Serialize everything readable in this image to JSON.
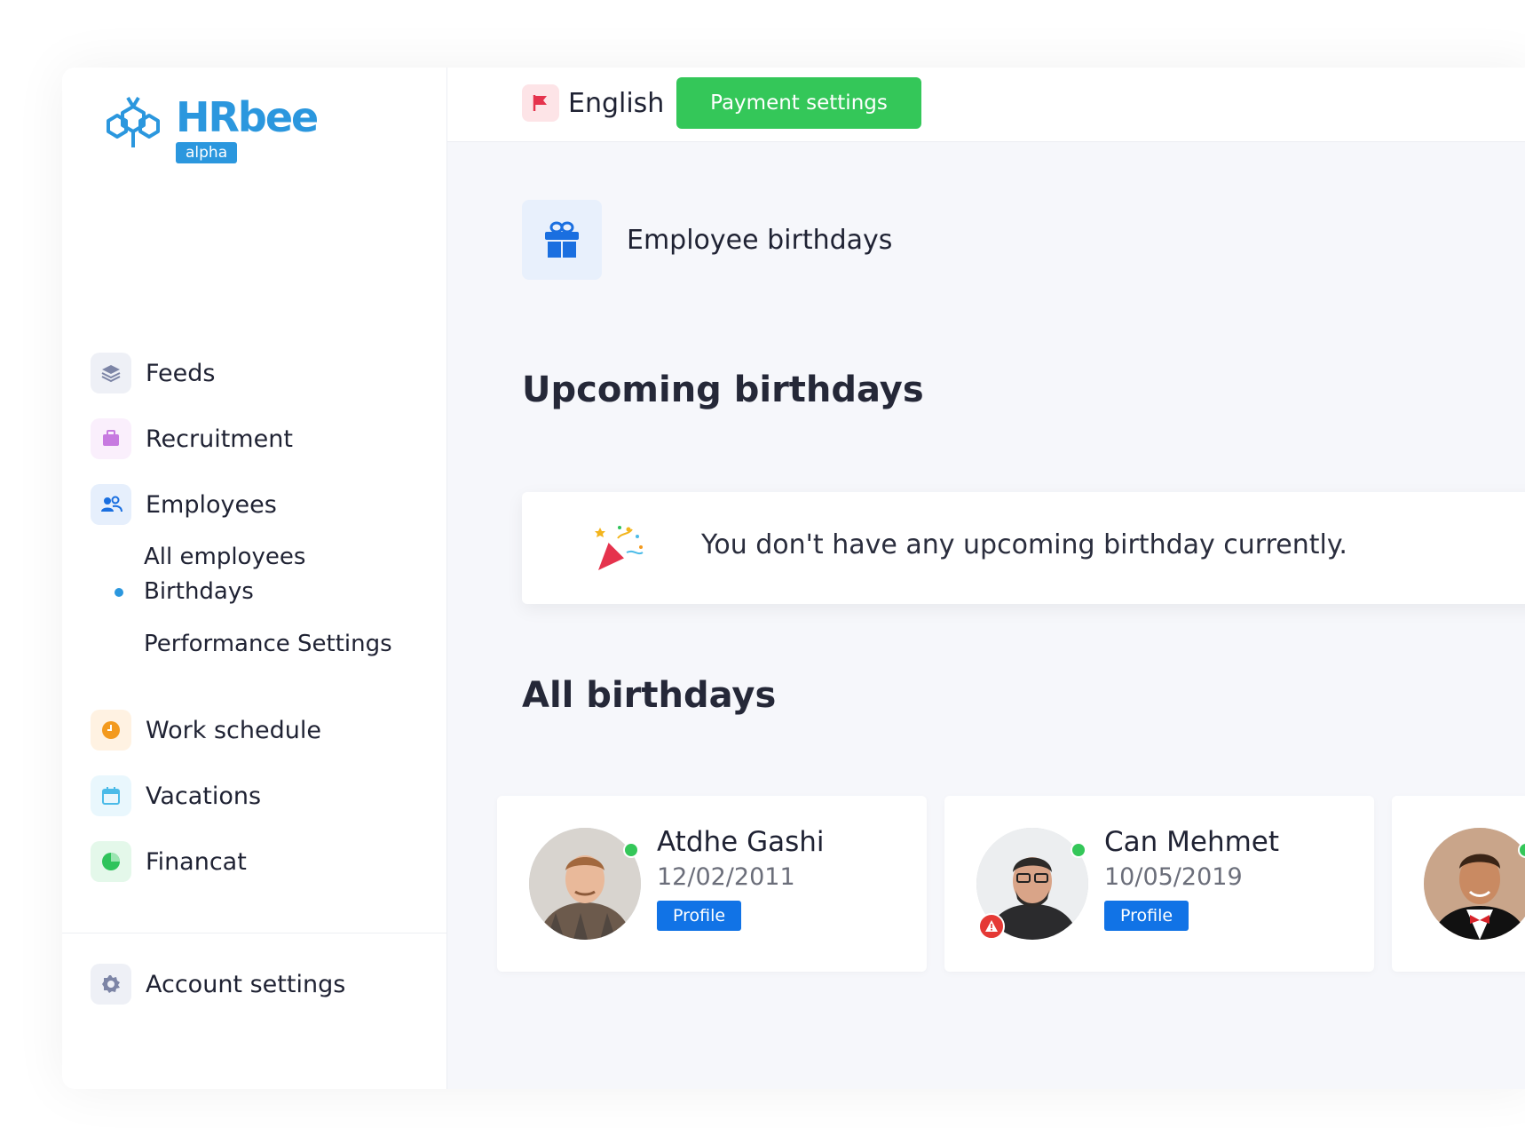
{
  "brand": {
    "name": "HRbee",
    "badge": "alpha",
    "color": "#2b97de"
  },
  "sidebar": {
    "items": [
      {
        "label": "Feeds",
        "icon": "layers-icon"
      },
      {
        "label": "Recruitment",
        "icon": "briefcase-icon"
      },
      {
        "label": "Employees",
        "icon": "users-icon"
      },
      {
        "label": "Work schedule",
        "icon": "clock-icon"
      },
      {
        "label": "Vacations",
        "icon": "calendar-icon"
      },
      {
        "label": "Financat",
        "icon": "pie-chart-icon"
      }
    ],
    "employees_sub": [
      {
        "label": "All employees",
        "active": false
      },
      {
        "label": "Birthdays",
        "active": true
      },
      {
        "label": "Performance Settings",
        "active": false
      }
    ],
    "footer": {
      "label": "Account settings",
      "icon": "gear-icon"
    }
  },
  "topbar": {
    "language": "English",
    "payment_button": "Payment settings",
    "payment_color": "#34c759"
  },
  "page": {
    "title": "Employee birthdays",
    "upcoming_heading": "Upcoming birthdays",
    "empty_message": "You don't have any upcoming birthday currently.",
    "all_heading": "All birthdays"
  },
  "employees": [
    {
      "name": "Atdhe Gashi",
      "date": "12/02/2011",
      "profile_label": "Profile",
      "online": true,
      "warning": false
    },
    {
      "name": "Can Mehmet",
      "date": "10/05/2019",
      "profile_label": "Profile",
      "online": true,
      "warning": true
    },
    {
      "name": "",
      "date": "",
      "profile_label": "",
      "online": true,
      "warning": false
    }
  ]
}
